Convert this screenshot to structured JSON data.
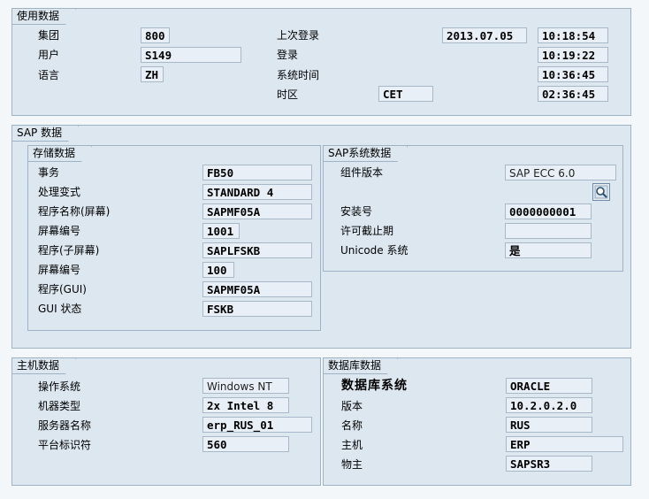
{
  "usage": {
    "title": "使用数据",
    "client_label": "集团",
    "client_value": "800",
    "user_label": "用户",
    "user_value": "S149",
    "language_label": "语言",
    "language_value": "ZH",
    "last_logon_label": "上次登录",
    "last_logon_date": "2013.07.05",
    "last_logon_time": "10:18:54",
    "logon_label": "登录",
    "logon_time": "10:19:22",
    "system_time_label": "系统时间",
    "system_time": "10:36:45",
    "timezone_label": "时区",
    "timezone_value": "CET",
    "timezone_time": "02:36:45"
  },
  "sap": {
    "title": "SAP 数据",
    "repo": {
      "title": "存储数据",
      "rows": [
        {
          "label": "事务",
          "value": "FB50"
        },
        {
          "label": "处理变式",
          "value": "STANDARD 4"
        },
        {
          "label": "程序名称(屏幕)",
          "value": "SAPMF05A"
        },
        {
          "label": "屏幕编号",
          "value": "1001"
        },
        {
          "label": "程序(子屏幕)",
          "value": "SAPLFSKB"
        },
        {
          "label": "屏幕编号",
          "value": "100"
        },
        {
          "label": "程序(GUI)",
          "value": "SAPMF05A"
        },
        {
          "label": "GUI 状态",
          "value": "FSKB"
        }
      ]
    },
    "system": {
      "title": "SAP系统数据",
      "component_label": "组件版本",
      "component_value": "SAP ECC 6.0",
      "install_label": "安装号",
      "install_value": "0000000001",
      "license_label": "许可截止期",
      "license_value": "",
      "unicode_label": "Unicode 系统",
      "unicode_value": "是",
      "details_icon": "magnifier-icon"
    }
  },
  "host": {
    "title": "主机数据",
    "os_label": "操作系统",
    "os_value": "Windows NT",
    "machine_label": "机器类型",
    "machine_value": "2x Intel 8",
    "server_label": "服务器名称",
    "server_value": "erp_RUS_01",
    "platform_label": "平台标识符",
    "platform_value": "560"
  },
  "db": {
    "title": "数据库数据",
    "system_label": "数据库系统",
    "system_value": "ORACLE",
    "release_label": "版本",
    "release_value": "10.2.0.2.0",
    "name_label": "名称",
    "name_value": "RUS",
    "host_label": "主机",
    "host_value": "ERP",
    "owner_label": "物主",
    "owner_value": "SAPSR3"
  }
}
